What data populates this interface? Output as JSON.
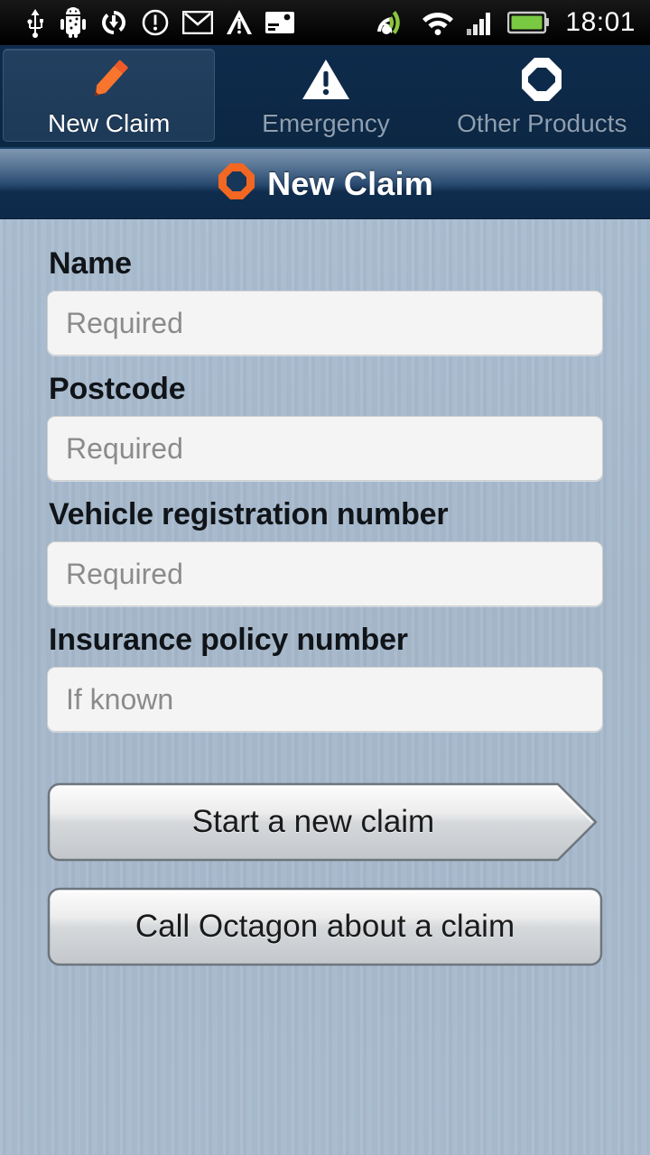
{
  "statusbar": {
    "time": "18:01",
    "left_icons": [
      "usb-icon",
      "android-debug-icon",
      "sync-download-icon",
      "alert-circle-icon",
      "gmail-icon",
      "upload-icon",
      "sim-card-icon"
    ],
    "right_icons": [
      "satellite-gps-icon",
      "wifi-icon",
      "cellular-signal-icon",
      "battery-icon"
    ]
  },
  "tabs": [
    {
      "label": "New Claim",
      "icon": "pencil-icon",
      "active": true
    },
    {
      "label": "Emergency",
      "icon": "warning-triangle-icon",
      "active": false
    },
    {
      "label": "Other Products",
      "icon": "octagon-icon",
      "active": false
    }
  ],
  "titlebar": {
    "title": "New Claim",
    "logo": "octagon-logo-icon"
  },
  "form": {
    "fields": [
      {
        "label": "Name",
        "value": "",
        "placeholder": "Required"
      },
      {
        "label": "Postcode",
        "value": "",
        "placeholder": "Required"
      },
      {
        "label": "Vehicle registration number",
        "value": "",
        "placeholder": "Required"
      },
      {
        "label": "Insurance policy number",
        "value": "",
        "placeholder": "If known"
      }
    ]
  },
  "actions": {
    "primary": "Start a new claim",
    "secondary": "Call Octagon about a claim"
  },
  "colors": {
    "brand_orange": "#f26722",
    "navy_dark": "#0d2a4a",
    "navy_tab_active": "#20405f",
    "background_blue": "#a8bacd",
    "input_bg": "#f4f4f4",
    "status_bar_black": "#000000",
    "battery_green": "#7ac943"
  }
}
